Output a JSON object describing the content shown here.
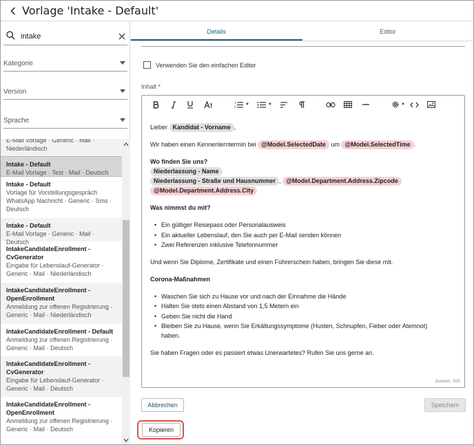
{
  "header": {
    "title": "Vorlage 'Intake - Default'"
  },
  "sidebar": {
    "search_value": "intake",
    "filters": {
      "kategorie": "Kategorie",
      "version": "Version",
      "sprache": "Sprache"
    },
    "list_partial_top": {
      "line1": "E-Mail Vorlage · Generic · Mail ·",
      "line2": "Niederländisch"
    },
    "items": [
      {
        "title": "Intake - Default",
        "sub": "E-Mail Vorlage · Test · Mail · Deutsch"
      },
      {
        "title": "Intake - Default",
        "sub1": "Vorlage für Vorstellungsgespräch",
        "sub2": "WhatsApp Nachricht · Generic · Sms ·",
        "sub3": "Deutsch"
      },
      {
        "title": "Intake - Default",
        "sub": "E-Mail Vorlage · Generic · Mail · Deutsch"
      },
      {
        "title1": "IntakeCandidateEnrollment -",
        "title2": "CvGenerator",
        "sub1": "Eingabe für Lebenslauf-Generator ·",
        "sub2": "Generic · Mail · Niederländisch"
      },
      {
        "title1": "IntakeCandidateEnrollment -",
        "title2": "OpenEnrollment",
        "sub1": "Anmeldung zur offenen Registrierung ·",
        "sub2": "Generic · Mail · Niederländisch"
      },
      {
        "title": "IntakeCandidateEnrollment - Default",
        "sub1": "Anmeldung zur offenen Registrierung ·",
        "sub2": "Generic · Mail · Deutsch"
      },
      {
        "title1": "IntakeCandidateEnrollment -",
        "title2": "CvGenerator",
        "sub1": "Eingabe für Lebenslauf-Generator ·",
        "sub2": "Generic · Mail · Deutsch"
      },
      {
        "title1": "IntakeCandidateEnrollment -",
        "title2": "OpenEnrollment",
        "sub1": "Anmeldung zur offenen Registrierung ·",
        "sub2": "Generic · Mail · Deutsch"
      }
    ]
  },
  "tabs": [
    {
      "label": "Details"
    },
    {
      "label": "Editor"
    }
  ],
  "details": {
    "simple_editor_label": "Verwenden Sie den einfachen Editor",
    "content_label": "Inhalt *",
    "char_count": "Zeichen : 835"
  },
  "content": {
    "greeting_pre": "Lieber",
    "greeting_chip": "Kandidat - Vorname",
    "greeting_post": ",",
    "appt_pre": "Wir haben einen Kennenlerntermin bei",
    "appt_chip_date": "@Model.SelectedDate",
    "appt_mid": "um",
    "appt_chip_time": "@Model.SelectedTime",
    "appt_post": ".",
    "where_heading": "Wo finden Sie uns?",
    "chip_branch_name": "Niederlassung - Name",
    "chip_branch_street": "Niederlassung - Straße und Hausnummer",
    "chip_sep": ",",
    "chip_zipcode": "@Model.Department.Address.Zipcode",
    "chip_city": "@Model.Department.Address.City",
    "bring_heading": "Was nimmst du mit?",
    "bring_items": [
      "Ein gültiger Reisepass oder Personalausweis",
      "Ein aktueller Lebenslauf, den Sie auch per E-Mail senden können",
      "Zwei Referenzen inklusive Telefonnummer"
    ],
    "diploma_text": "Und wenn Sie Diplome, Zertifikate und einen Führerschein haben, bringen Sie diese mit.",
    "corona_heading": "Corona-Maßnahmen",
    "corona_items": [
      "Waschen Sie sich zu Hause vor und nach der Einnahme die Hände",
      "Halten Sie stets einen Abstand von 1,5 Metern ein",
      "Geben Sie nicht die Hand",
      "Bleiben Sie zu Hause, wenn Sie Erkältungssymptome (Husten, Schnupfen, Fieber oder Atemnot)"
    ],
    "corona_last_cont": "haben.",
    "closing": "Sie haben Fragen oder es passiert etwas Unerwartetes? Rufen Sie uns gerne an."
  },
  "buttons": {
    "cancel": "Abbrechen",
    "save": "Speichern",
    "copy": "Kopieren"
  },
  "colors": {
    "accent": "#1f5f7f",
    "chip_gray": "#e0e0e0",
    "chip_red": "#f7d0d3",
    "highlight": "#d9534f"
  }
}
